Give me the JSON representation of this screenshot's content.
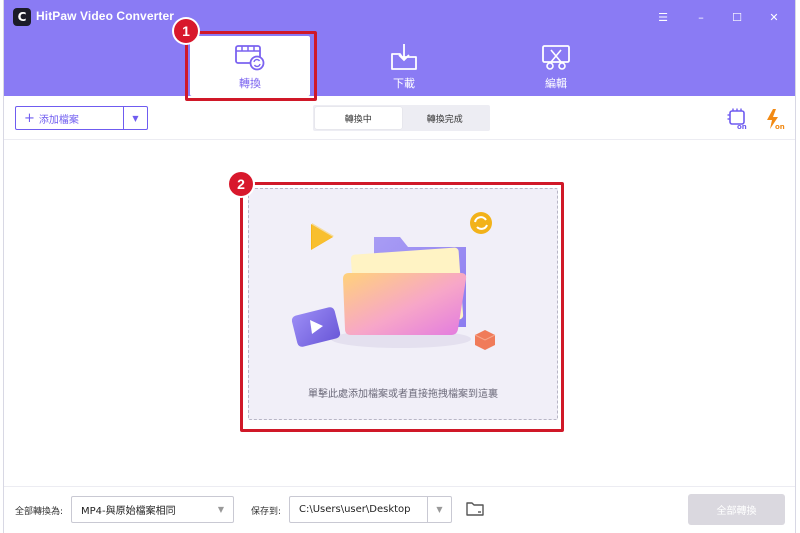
{
  "app": {
    "title": "HitPaw Video Converter",
    "logo_letter": "C"
  },
  "window_controls": {
    "menu": "☰",
    "minimize": "–",
    "maximize": "☐",
    "close": "✕"
  },
  "tabs": [
    {
      "label": "轉換",
      "icon": "convert-film-icon",
      "active": true
    },
    {
      "label": "下載",
      "icon": "download-folder-icon",
      "active": false
    },
    {
      "label": "編輯",
      "icon": "edit-scissors-icon",
      "active": false
    }
  ],
  "callouts": {
    "one": "1",
    "two": "2"
  },
  "toolbar": {
    "add_files_plus": "+",
    "add_files_label": "添加檔案",
    "add_files_caret": "▼",
    "segments": [
      {
        "label": "轉換中",
        "active": true
      },
      {
        "label": "轉換完成",
        "active": false
      }
    ],
    "hw_accel_icon": "hardware-acceleration-on-icon",
    "fast_icon": "lightning-on-icon"
  },
  "dropzone": {
    "text": "單擊此處添加檔案或者直接拖拽檔案到這裏"
  },
  "bottom": {
    "convert_all_to_label": "全部轉換為:",
    "format_value": "MP4-與原始檔案相同",
    "save_to_label": "保存到:",
    "path_value": "C:\\Users\\user\\Desktop",
    "caret": "▼",
    "convert_all_button": "全部轉換"
  },
  "colors": {
    "brand": "#8a7bf4",
    "accent": "#6f5cf0",
    "callout": "#d01828"
  }
}
